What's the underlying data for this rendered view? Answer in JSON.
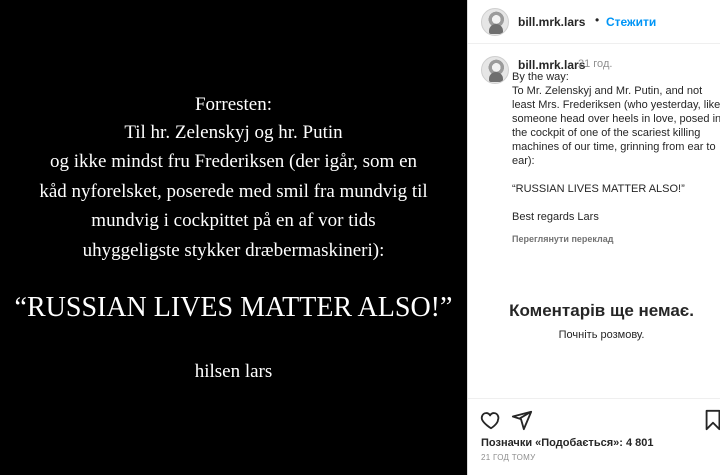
{
  "post": {
    "image_text": {
      "intro": "Forresten:",
      "lines": [
        "Til hr. Zelenskyj og hr. Putin",
        "og ikke mindst fru Frederiksen (der igår, som en",
        "kåd nyforelsket, poserede med smil fra mundvig til",
        "mundvig i cockpittet på en af vor tids",
        "uhyggeligste stykker dræbermaskineri):"
      ],
      "headline": "“RUSSIAN LIVES MATTER ALSO!”",
      "signoff": "hilsen lars"
    }
  },
  "header": {
    "username": "bill.mrk.lars",
    "separator": "•",
    "follow_label": "Стежити"
  },
  "comment": {
    "username": "bill.mrk.lars",
    "time": "21 год.",
    "text": "By the way:\nTo Mr. Zelenskyj and Mr. Putin, and not least Mrs. Frederiksen (who yesterday, like someone head over heels in love, posed in the cockpit of one of the scariest killing machines of our time, grinning from ear to ear):\n\n“RUSSIAN LIVES MATTER ALSO!”\n\nBest regards Lars",
    "translate_label": "Переглянути переклад"
  },
  "empty_state": {
    "title": "Коментарів ще немає.",
    "subtitle": "Почніть розмову."
  },
  "footer": {
    "likes": "Позначки «Подобається»: 4 801",
    "ago": "21 ГОД ТОМУ"
  },
  "icons": {
    "like": "heart-icon",
    "share": "send-icon",
    "save": "bookmark-icon"
  }
}
